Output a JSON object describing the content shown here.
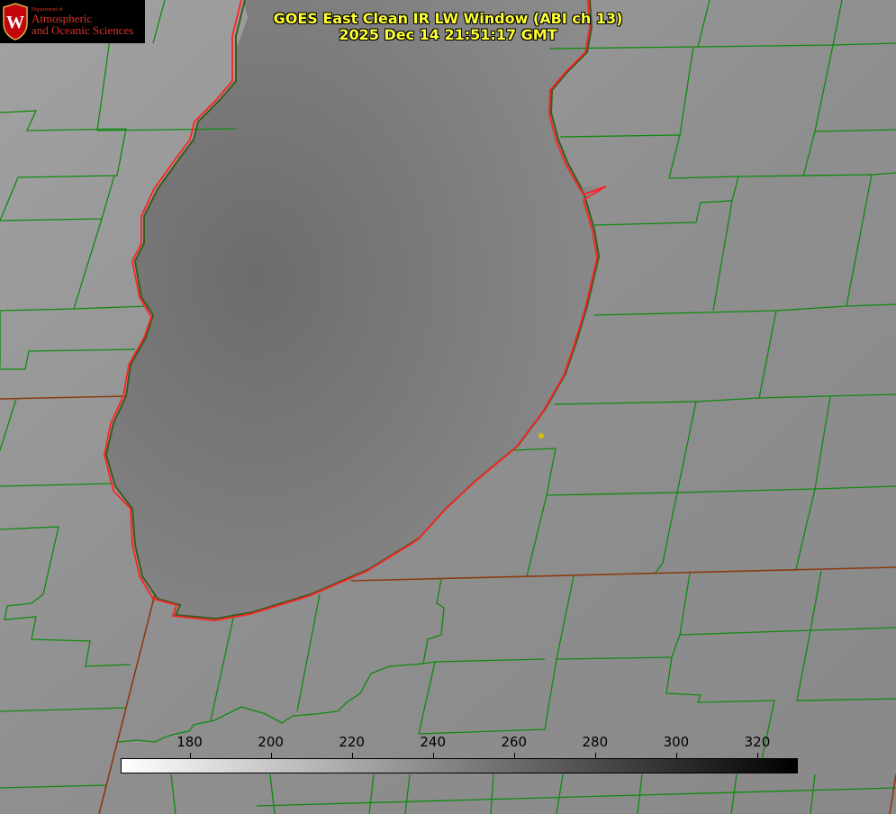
{
  "title": {
    "line1": "GOES East Clean IR LW Window (ABI ch 13)",
    "line2": "2025 Dec 14 21:51:17 GMT"
  },
  "logo": {
    "line1": "Department of",
    "line2": "Atmospheric",
    "line3": "and Oceanic Sciences",
    "seal_letter": "W",
    "seal_color": "#c5050c"
  },
  "colorbar": {
    "min": 163,
    "max": 330,
    "gradient_start": "#ffffff",
    "gradient_end": "#000000",
    "ticks": [
      180,
      200,
      220,
      240,
      260,
      280,
      300,
      320
    ]
  },
  "colors": {
    "background_land": "#8e8e8e",
    "lake_dark": "#6e6e6e",
    "county_lines": "#0f8a0f",
    "state_lines": "#8a3a10",
    "coastline": "#ff2222",
    "title_text": "#ffff33",
    "marker": "#d4c000"
  },
  "icons": {
    "seal": "uw-crest-icon",
    "marker": "location-dot-icon"
  }
}
